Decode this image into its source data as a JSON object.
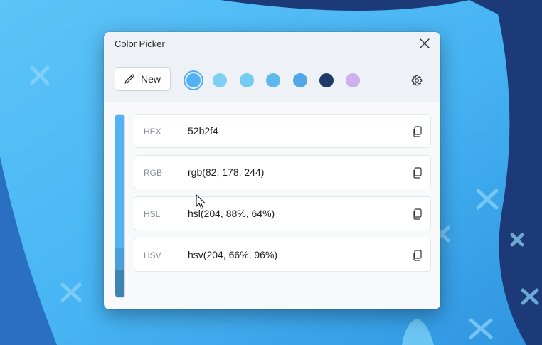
{
  "window": {
    "title": "Color Picker"
  },
  "toolbar": {
    "new_label": "New"
  },
  "swatches": [
    {
      "color": "#52b2f4",
      "selected": true
    },
    {
      "color": "#7fcff5"
    },
    {
      "color": "#74cbf3"
    },
    {
      "color": "#5fb9f0"
    },
    {
      "color": "#52a7e8"
    },
    {
      "color": "#1e3a6b"
    },
    {
      "color": "#cdb1ee"
    }
  ],
  "shades": [
    "#52b2f4",
    "#52b2f4",
    "#4a9fd8",
    "#3d83b4"
  ],
  "formats": [
    {
      "label": "HEX",
      "value": "52b2f4"
    },
    {
      "label": "RGB",
      "value": "rgb(82, 178, 244)"
    },
    {
      "label": "HSL",
      "value": "hsl(204, 88%, 64%)"
    },
    {
      "label": "HSV",
      "value": "hsv(204, 66%, 96%)"
    }
  ],
  "icons": {
    "close": "close-icon",
    "eyedropper": "eyedropper-icon",
    "settings": "gear-icon",
    "copy": "copy-icon"
  }
}
